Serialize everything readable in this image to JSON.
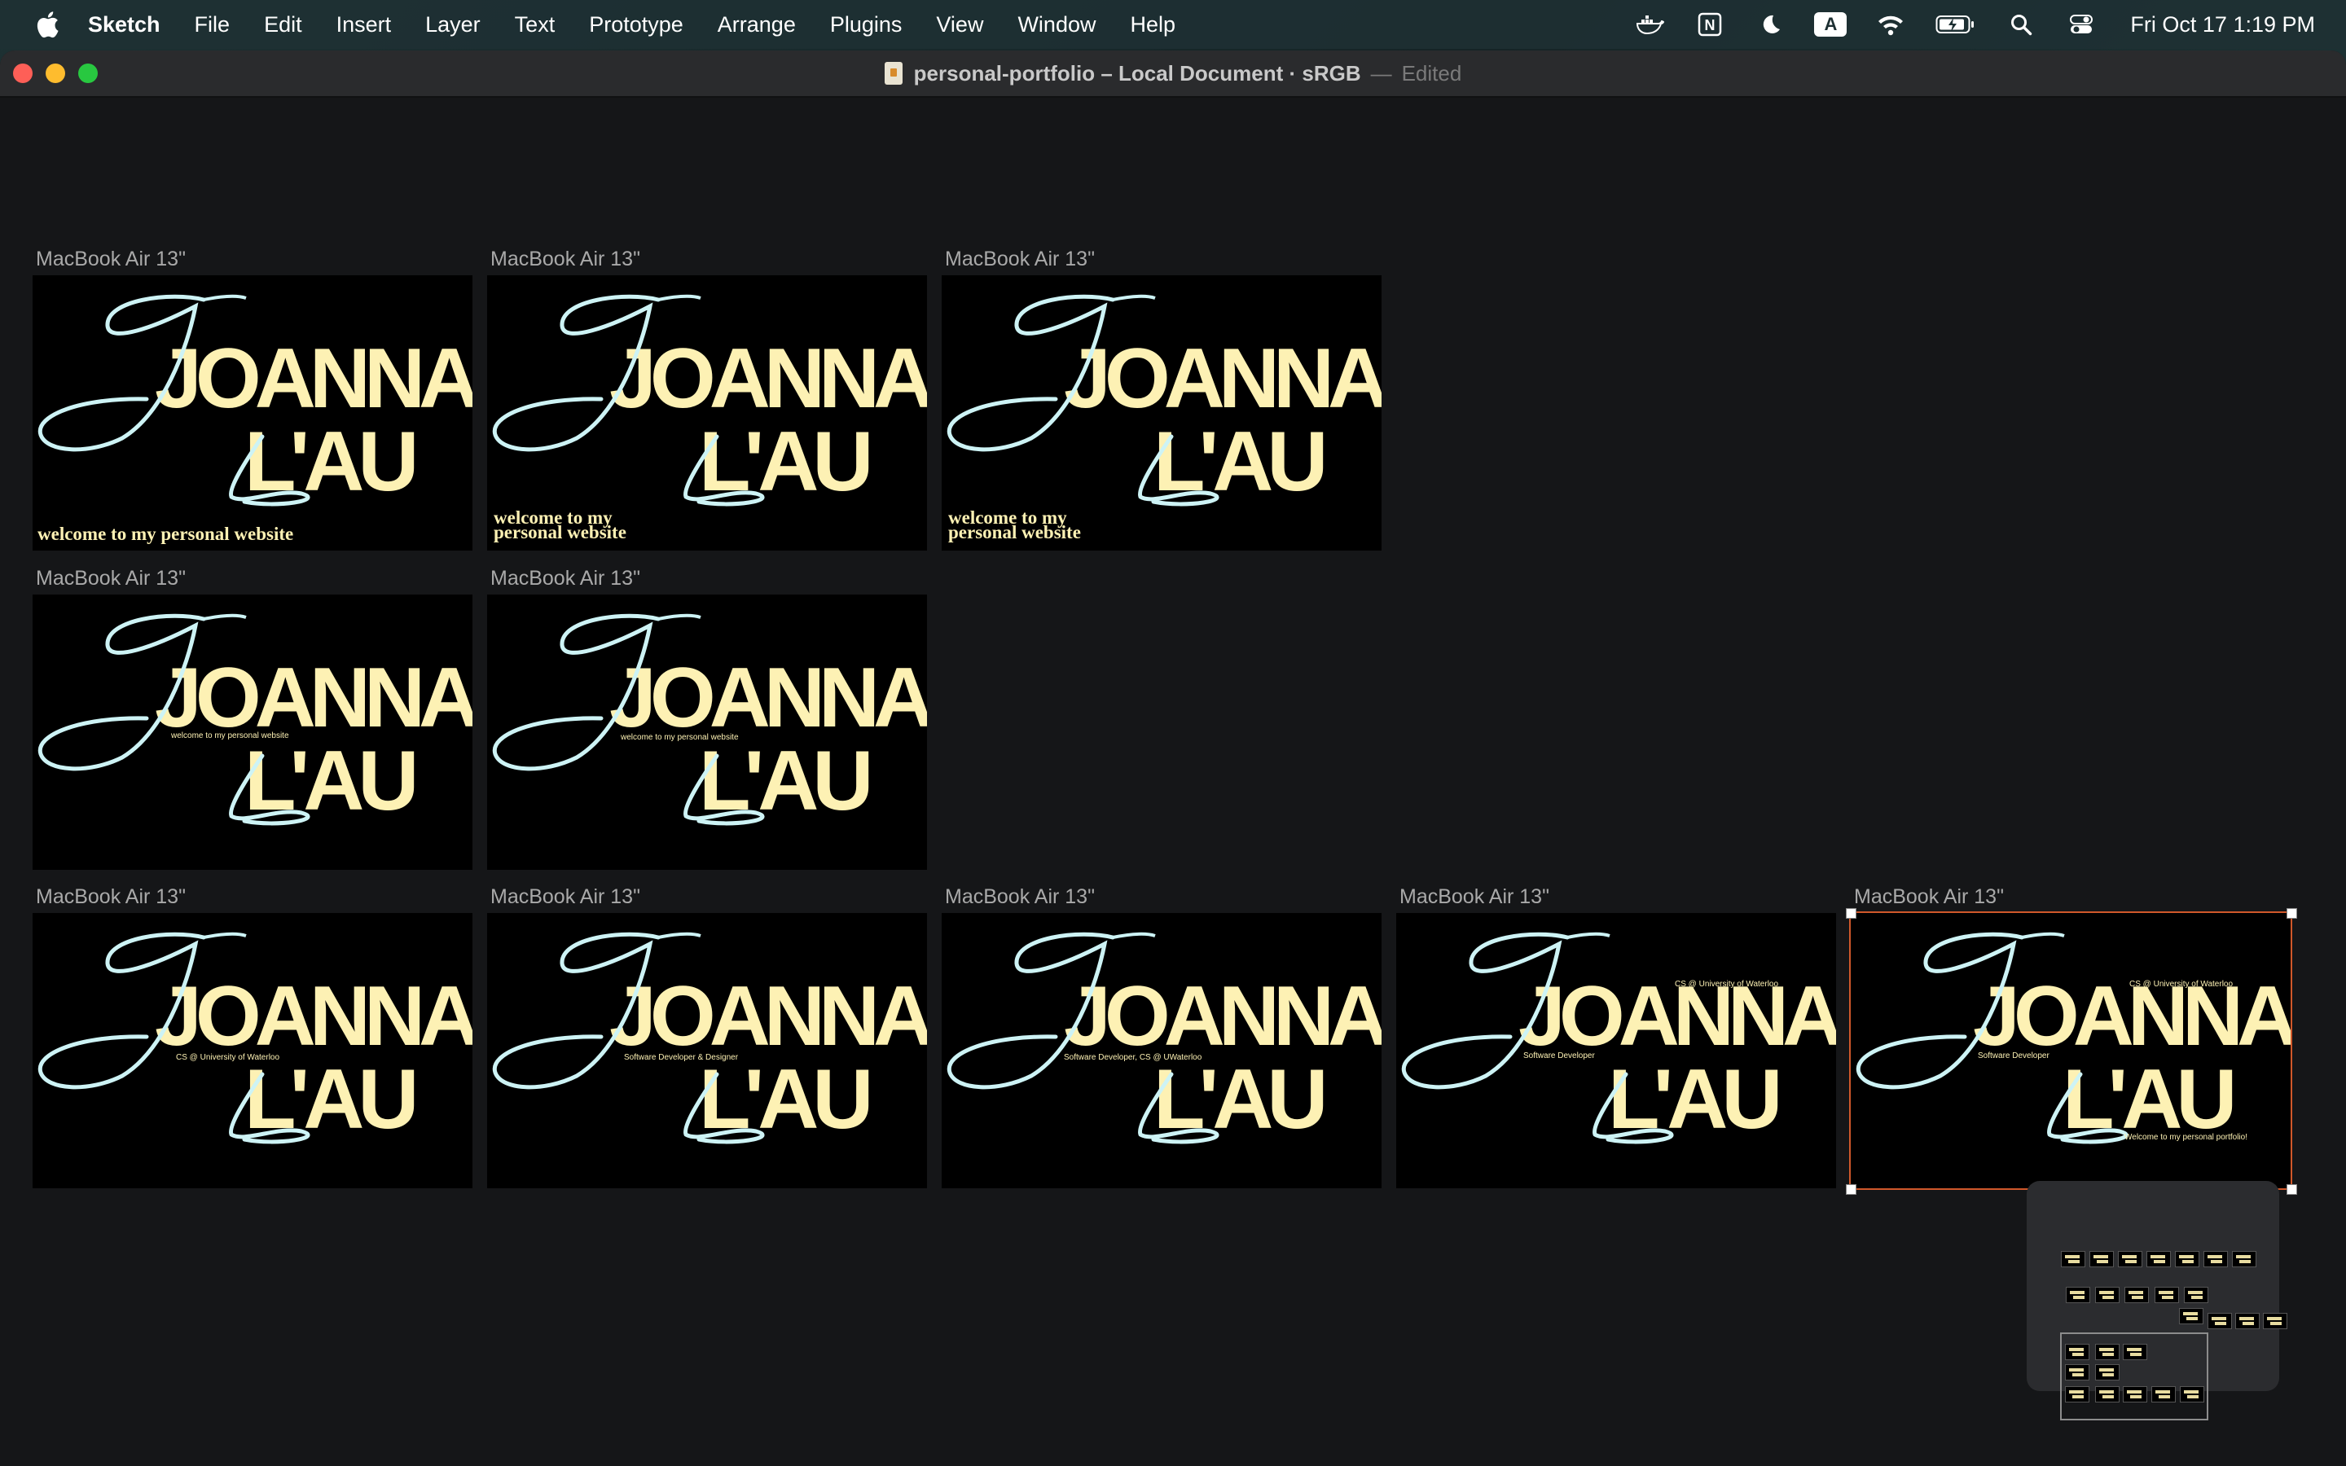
{
  "menubar": {
    "app": "Sketch",
    "items": [
      "File",
      "Edit",
      "Insert",
      "Layer",
      "Text",
      "Prototype",
      "Arrange",
      "Plugins",
      "View",
      "Window",
      "Help"
    ],
    "status_icons": [
      "docker-icon",
      "notion-icon",
      "moon-icon",
      "input-source-icon",
      "wifi-icon",
      "battery-icon",
      "search-icon",
      "control-center-icon"
    ],
    "input_source": "A",
    "notion_letter": "N",
    "clock": "Fri Oct 17  1:19 PM"
  },
  "window": {
    "title": "personal-portfolio – Local Document · sRGB",
    "separator": "—",
    "status": "Edited"
  },
  "artboard_label": "MacBook Air 13\"",
  "logo": {
    "first": "JOANNA",
    "last": "L'AU"
  },
  "artboards": [
    {
      "id": "row1-1",
      "subtitle": [
        "welcome to my personal website"
      ],
      "style": "big-one-line"
    },
    {
      "id": "row1-2",
      "subtitle": [
        "welcome to my",
        "personal website"
      ],
      "style": "big-two-line"
    },
    {
      "id": "row1-3",
      "subtitle": [
        "welcome to my",
        "personal website"
      ],
      "style": "big-two-line"
    },
    {
      "id": "row2-1",
      "subtitle": [
        "welcome to my personal website"
      ],
      "style": "small-center"
    },
    {
      "id": "row2-2",
      "subtitle": [
        "welcome to my personal website"
      ],
      "style": "small-center"
    },
    {
      "id": "row3-1",
      "subtitle": [
        "CS @ University of Waterloo"
      ],
      "style": "small-center"
    },
    {
      "id": "row3-2",
      "subtitle": [
        "Software Developer & Designer"
      ],
      "style": "small-center"
    },
    {
      "id": "row3-3",
      "subtitle": [
        "Software Developer, CS @ UWaterloo"
      ],
      "style": "small-center"
    },
    {
      "id": "row3-4",
      "subtitle": [
        "CS @ University of Waterloo",
        "Software Developer"
      ],
      "style": "small-split"
    },
    {
      "id": "row3-5",
      "subtitle": [
        "CS @ University of Waterloo",
        "Software Developer",
        "Welcome to my personal portfolio!"
      ],
      "style": "small-split-3",
      "selected": true
    }
  ],
  "colors": {
    "accent": "#d0582a",
    "logo_block": "#fdf1b4",
    "script": "#cdf3f5",
    "canvas": "#151618"
  }
}
